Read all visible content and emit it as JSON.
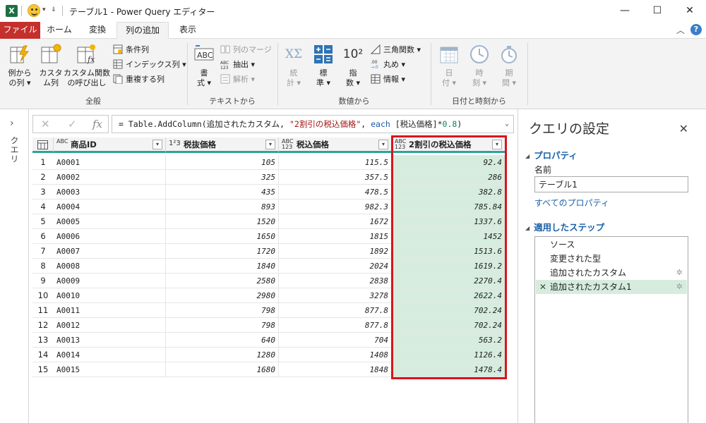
{
  "window": {
    "title": "テーブル1 - Power Query エディター",
    "logo": "X",
    "qat_caret": "▾",
    "qat_more": "⇓",
    "minimize": "—",
    "maximize": "☐",
    "close": "✕"
  },
  "tabs": [
    {
      "label": "ファイル"
    },
    {
      "label": "ホーム"
    },
    {
      "label": "変換"
    },
    {
      "label": "列の追加"
    },
    {
      "label": "表示"
    }
  ],
  "ribbon_misc": {
    "collapse": "︿",
    "help": "?"
  },
  "ribbon": {
    "general": {
      "label": "全般",
      "example_col": {
        "line1": "例から",
        "line2": "の列 ▾"
      },
      "custom_col": {
        "line1": "カスタ",
        "line2": "ム列"
      },
      "invoke_custom": {
        "line1": "カスタム関数",
        "line2": "の呼び出し"
      },
      "conditional": "条件列",
      "index": "インデックス列 ▾",
      "duplicate": "重複する列"
    },
    "text": {
      "label": "テキストから",
      "format": {
        "line1": "書",
        "line2": "式 ▾"
      },
      "merge": "列のマージ",
      "extract": "抽出 ▾",
      "parse": "解析 ▾"
    },
    "number": {
      "label": "数値から",
      "stats": {
        "line1": "統",
        "line2": "計 ▾"
      },
      "standard": {
        "line1": "標",
        "line2": "準 ▾"
      },
      "scientific": {
        "line1": "指",
        "line2": "数 ▾"
      },
      "trig": "三角関数 ▾",
      "round": "丸め ▾",
      "info": "情報 ▾",
      "sci_glyph": "10²",
      "stats_glyph": "XΣ"
    },
    "datetime": {
      "label": "日付と時刻から",
      "date": {
        "line1": "日",
        "line2": "付 ▾"
      },
      "time": {
        "line1": "時",
        "line2": "刻 ▾"
      },
      "duration": {
        "line1": "期",
        "line2": "間 ▾"
      }
    }
  },
  "side": {
    "chevron": "›",
    "label": "クエリ"
  },
  "formula_bar": {
    "cancel": "✕",
    "confirm": "✓",
    "fx": "fx",
    "expand": "⌄",
    "prefix": "= Table.AddColumn(追加されたカスタム, ",
    "string": "\"2割引の税込価格\"",
    "sep": ", ",
    "keyword": "each",
    "expr": " [税込価格]*",
    "number": "0.8",
    "suffix": ")"
  },
  "table": {
    "columns": [
      {
        "type": "ABC",
        "type_sub": "",
        "name": "商品ID"
      },
      {
        "type": "1²3",
        "type_sub": "",
        "name": "税抜価格"
      },
      {
        "type": "ABC",
        "type_sub": "123",
        "name": "税込価格"
      },
      {
        "type": "ABC",
        "type_sub": "123",
        "name": "2割引の税込価格"
      }
    ],
    "filter_glyph": "▾",
    "rows": [
      [
        "1",
        "A0001",
        "105",
        "115.5",
        "92.4"
      ],
      [
        "2",
        "A0002",
        "325",
        "357.5",
        "286"
      ],
      [
        "3",
        "A0003",
        "435",
        "478.5",
        "382.8"
      ],
      [
        "4",
        "A0004",
        "893",
        "982.3",
        "785.84"
      ],
      [
        "5",
        "A0005",
        "1520",
        "1672",
        "1337.6"
      ],
      [
        "6",
        "A0006",
        "1650",
        "1815",
        "1452"
      ],
      [
        "7",
        "A0007",
        "1720",
        "1892",
        "1513.6"
      ],
      [
        "8",
        "A0008",
        "1840",
        "2024",
        "1619.2"
      ],
      [
        "9",
        "A0009",
        "2580",
        "2838",
        "2270.4"
      ],
      [
        "10",
        "A0010",
        "2980",
        "3278",
        "2622.4"
      ],
      [
        "11",
        "A0011",
        "798",
        "877.8",
        "702.24"
      ],
      [
        "12",
        "A0012",
        "798",
        "877.8",
        "702.24"
      ],
      [
        "13",
        "A0013",
        "640",
        "704",
        "563.2"
      ],
      [
        "14",
        "A0014",
        "1280",
        "1408",
        "1126.4"
      ],
      [
        "15",
        "A0015",
        "1680",
        "1848",
        "1478.4"
      ]
    ]
  },
  "query_settings": {
    "title": "クエリの設定",
    "close": "✕",
    "properties_label": "プロパティ",
    "name_label": "名前",
    "name_value": "テーブル1",
    "all_properties": "すべてのプロパティ",
    "applied_steps_label": "適用したステップ",
    "steps": [
      {
        "label": "ソース",
        "gear": ""
      },
      {
        "label": "変更された型",
        "gear": ""
      },
      {
        "label": "追加されたカスタム",
        "gear": "✲"
      },
      {
        "label": "追加されたカスタム1",
        "gear": "✲"
      }
    ],
    "delete_glyph": "✕"
  },
  "colors": {
    "file_tab": "#c4302b",
    "header_underline": "#2aa59a",
    "selected_column": "#d6ecde",
    "highlight_border": "#d9141c",
    "link_blue": "#1b61a8"
  }
}
